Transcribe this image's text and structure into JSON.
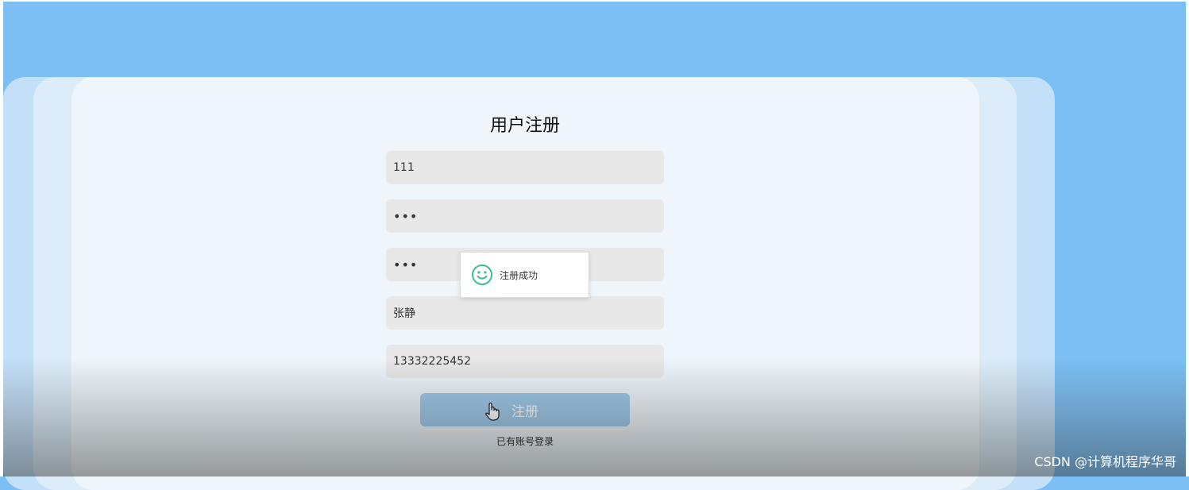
{
  "form": {
    "title": "用户注册",
    "fields": [
      {
        "value": "111"
      },
      {
        "value": "•••"
      },
      {
        "value": "•••"
      },
      {
        "value": "张静"
      },
      {
        "value": "13332225452"
      }
    ],
    "submit_label": "注册",
    "login_link": "已有账号登录"
  },
  "toast": {
    "message": "注册成功",
    "icon": "smile-icon",
    "color": "#3cbf8a"
  },
  "watermark": "CSDN @计算机程序华哥",
  "colors": {
    "background": "#7bbff4",
    "card": "#eef6fb",
    "button": "#9cc9ea"
  }
}
